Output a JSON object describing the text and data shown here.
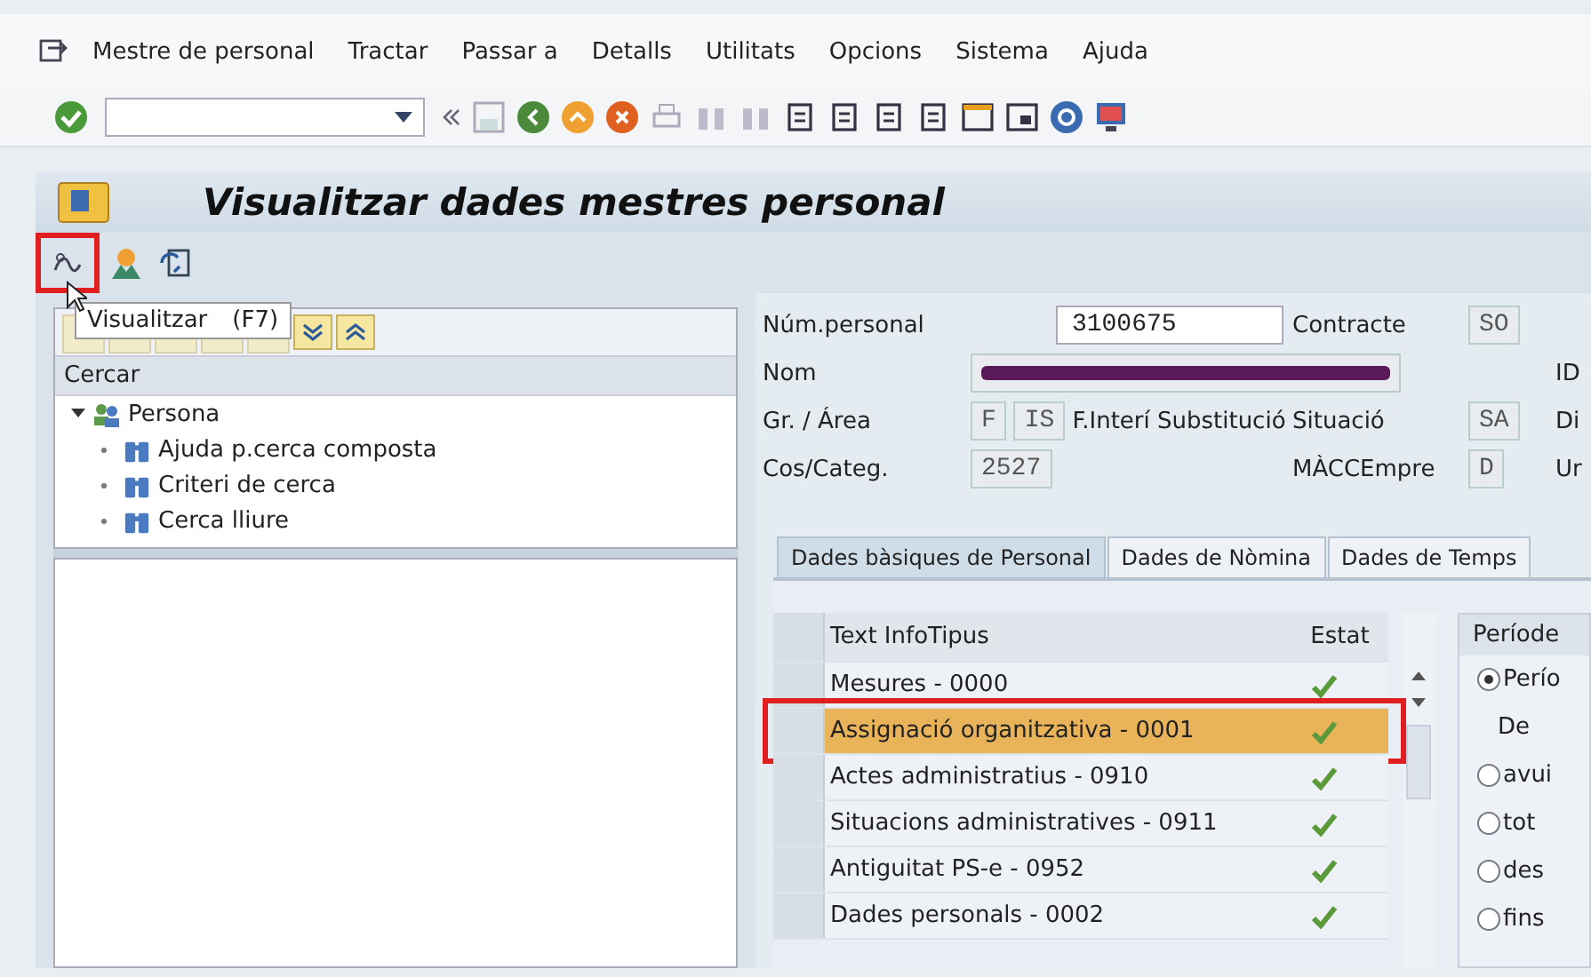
{
  "menu": [
    {
      "label": "Mestre de personal"
    },
    {
      "label": "Tractar"
    },
    {
      "label": "Passar a"
    },
    {
      "label": "Detalls"
    },
    {
      "label": "Utilitats"
    },
    {
      "label": "Opcions"
    },
    {
      "label": "Sistema"
    },
    {
      "label": "Ajuda"
    }
  ],
  "title": "Visualitzar dades mestres personal",
  "app_toolbar": [
    {
      "kind": "display",
      "highlighted": true
    },
    {
      "kind": "person",
      "highlighted": false
    },
    {
      "kind": "refresh",
      "highlighted": false
    }
  ],
  "tooltip": {
    "label": "Visualitzar",
    "shortcut": "(F7)"
  },
  "search_panel": {
    "header": "Cercar",
    "tree": [
      {
        "label": "Persona",
        "expanded": true,
        "children": [
          {
            "label": "Ajuda p.cerca composta"
          },
          {
            "label": "Criteri de cerca"
          },
          {
            "label": "Cerca lliure"
          }
        ]
      }
    ]
  },
  "header": {
    "rows": [
      {
        "label": "Núm.personal",
        "cells": [
          {
            "kind": "empty"
          },
          {
            "kind": "empty"
          },
          {
            "kind": "input",
            "value": "3100675"
          }
        ],
        "label2": "Contracte",
        "value2": "SO",
        "label3": ""
      },
      {
        "label": "Nom",
        "cells": [
          {
            "kind": "redacted"
          }
        ],
        "label2": "",
        "value2": "",
        "label3": "ID"
      },
      {
        "label": "Gr. / Área",
        "cells": [
          {
            "kind": "field",
            "value": "F"
          },
          {
            "kind": "field",
            "value": "IS"
          },
          {
            "kind": "text",
            "value": "F.Interí Substitució"
          }
        ],
        "label2": "Situació",
        "value2": "SA",
        "label3": "Di"
      },
      {
        "label": "Cos/Categ.",
        "cells": [
          {
            "kind": "field",
            "value": "2527"
          }
        ],
        "label2": "MÀCCEmpre",
        "value2": "D",
        "label3": "Ur"
      }
    ]
  },
  "tabs": [
    {
      "label": "Dades bàsiques de Personal",
      "selected": true
    },
    {
      "label": "Dades de Nòmina",
      "selected": false
    },
    {
      "label": "Dades de Temps",
      "selected": false
    }
  ],
  "table": {
    "columns": [
      "Text InfoTipus",
      "Estat"
    ],
    "rows": [
      {
        "text": "Mesures - 0000",
        "ok": true,
        "selected": false,
        "highlighted": false
      },
      {
        "text": "Assignació organitzativa - 0001",
        "ok": true,
        "selected": true,
        "highlighted": true
      },
      {
        "text": "Actes administratius - 0910",
        "ok": true,
        "selected": false,
        "highlighted": false
      },
      {
        "text": "Situacions administratives - 0911",
        "ok": true,
        "selected": false,
        "highlighted": false
      },
      {
        "text": "Antiguitat PS-e - 0952",
        "ok": true,
        "selected": false,
        "highlighted": false
      },
      {
        "text": "Dades personals - 0002",
        "ok": true,
        "selected": false,
        "highlighted": false
      }
    ]
  },
  "period": {
    "title": "Període",
    "options": [
      {
        "label": "Perío",
        "selected": true
      },
      {
        "label": "avui",
        "selected": false
      },
      {
        "label": "tot",
        "selected": false
      },
      {
        "label": "des",
        "selected": false
      },
      {
        "label": "fins",
        "selected": false
      }
    ],
    "from_label": "De"
  }
}
